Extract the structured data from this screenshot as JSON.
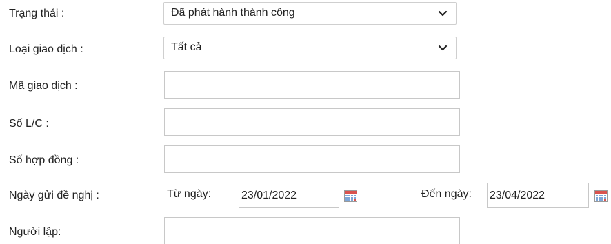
{
  "form": {
    "status": {
      "label": "Trạng thái :",
      "value": "Đã phát hành thành công"
    },
    "transaction_type": {
      "label": "Loại giao dịch :",
      "value": "Tất cả"
    },
    "transaction_code": {
      "label": "Mã giao dịch :",
      "value": ""
    },
    "lc_number": {
      "label": "Số L/C :",
      "value": ""
    },
    "contract_number": {
      "label": "Số hợp đồng :",
      "value": ""
    },
    "request_date": {
      "label": "Ngày gửi đề nghị :",
      "from_label": "Từ ngày:",
      "from_value": "23/01/2022",
      "to_label": "Đến ngày:",
      "to_value": "23/04/2022"
    },
    "creator": {
      "label": "Người lập:",
      "value": ""
    }
  },
  "icons": {
    "select_arrow": "chevron-down-icon",
    "date_picker": "calendar-icon"
  },
  "colors": {
    "calendar_header": "#d9534f",
    "calendar_cells": "#7ea6d8"
  }
}
